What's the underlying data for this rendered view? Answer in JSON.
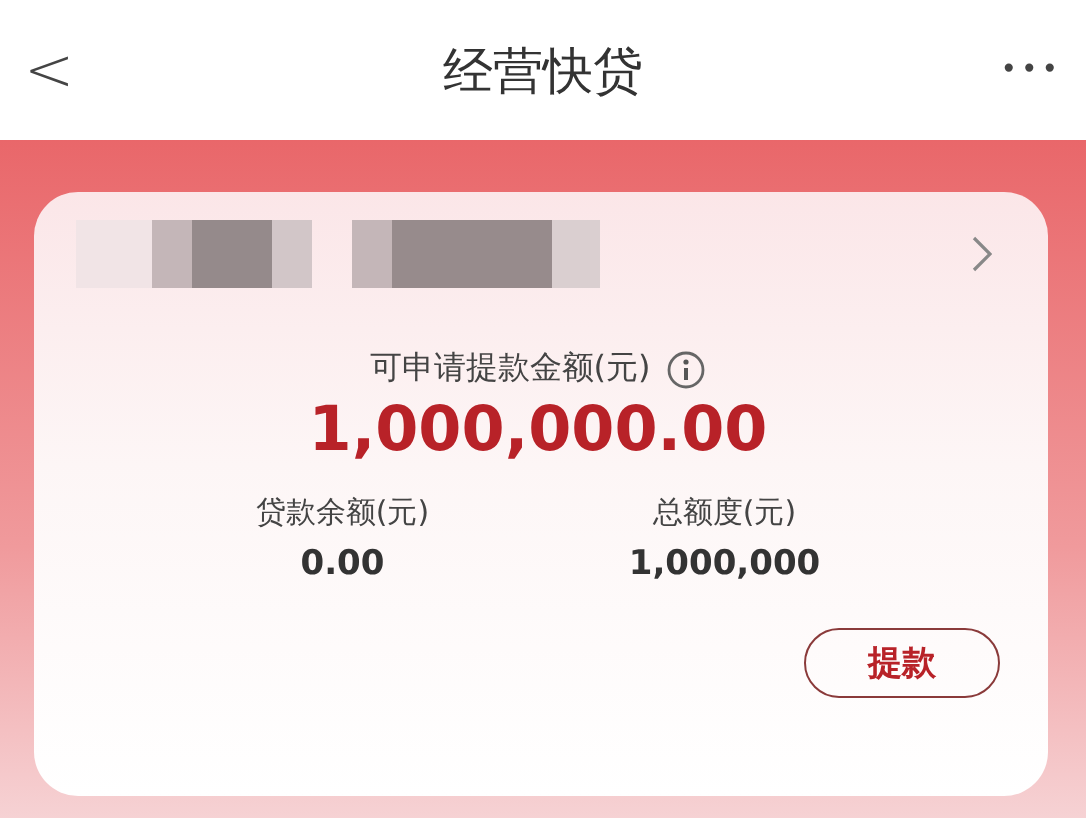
{
  "header": {
    "back": "<",
    "title": "经营快贷",
    "more": "•••"
  },
  "card": {
    "label": "可申请提款金额(元)",
    "amount": "1,000,000.00",
    "stats": [
      {
        "label": "贷款余额(元)",
        "value": "0.00"
      },
      {
        "label": "总额度(元)",
        "value": "1,000,000"
      }
    ],
    "button": "提款"
  }
}
